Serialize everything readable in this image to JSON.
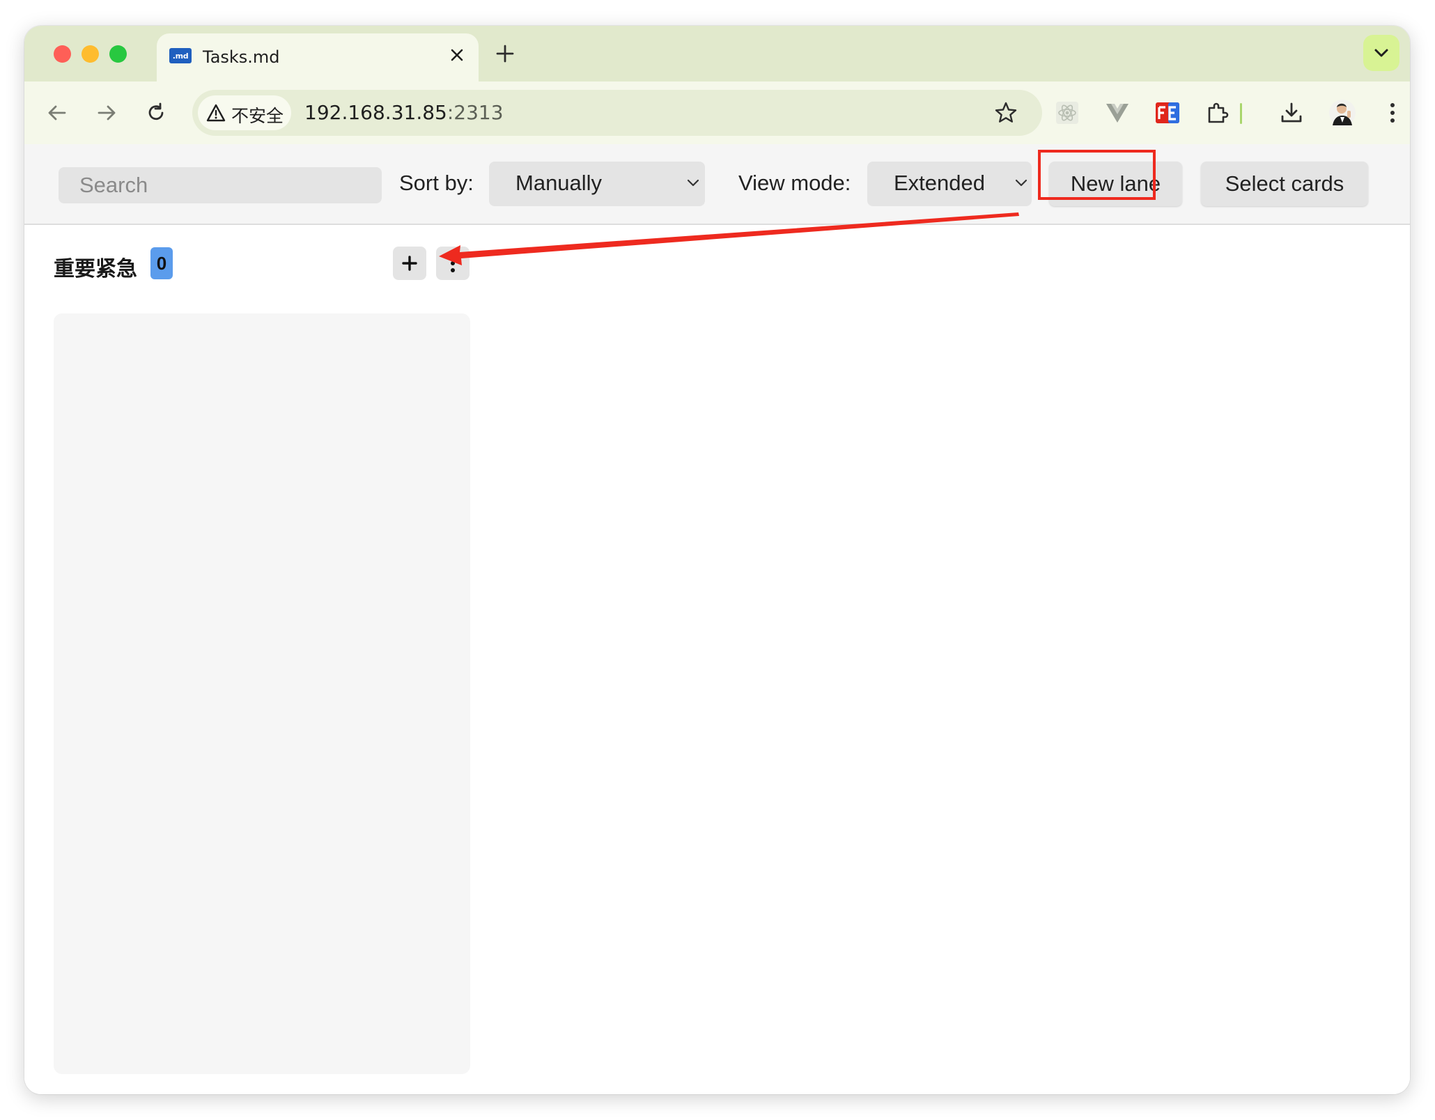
{
  "browser": {
    "tab": {
      "favicon_label": ".md",
      "title": "Tasks.md"
    },
    "security_label": "不安全",
    "url_host": "192.168.31.85",
    "url_port": ":2313"
  },
  "app": {
    "search_placeholder": "Search",
    "sort_label": "Sort by:",
    "sort_value": "Manually",
    "view_label": "View mode:",
    "view_value": "Extended",
    "new_lane_label": "New lane",
    "select_cards_label": "Select cards"
  },
  "lane": {
    "title": "重要紧急",
    "count": "0"
  },
  "annotation": {
    "color": "#ee2a1f"
  }
}
